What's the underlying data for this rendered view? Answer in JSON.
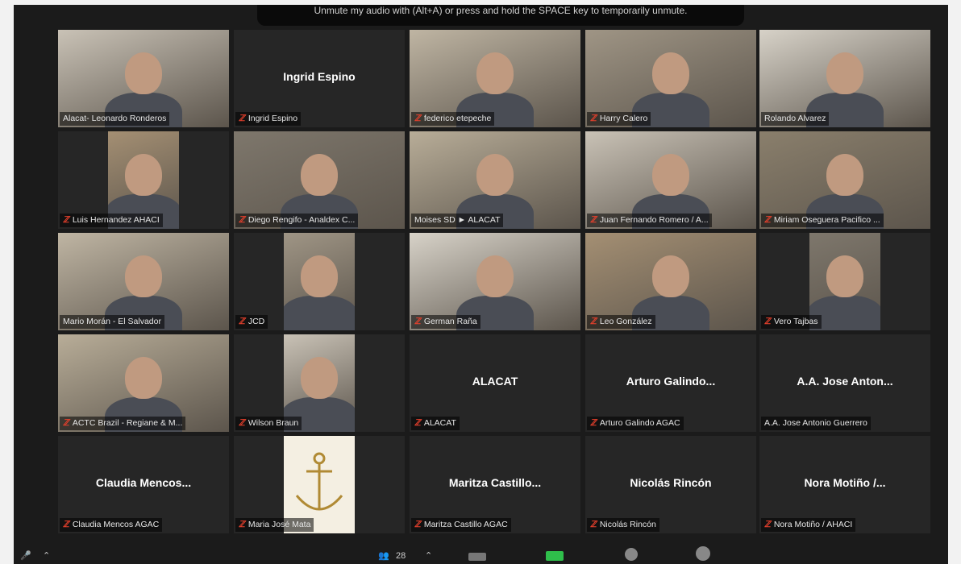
{
  "notice": "Unmute my audio with (Alt+A) or press and hold the SPACE key to temporarily unmute.",
  "colors": {
    "background": "#1b1b1b",
    "tile": "#262626",
    "speaker_outline": "#c7de6a",
    "muted_mic": "#e8402c"
  },
  "toolbar": {
    "participants_count": "28"
  },
  "participants": [
    {
      "label": "Alacat- Leonardo Ronderos",
      "big": "",
      "video": true,
      "muted": false
    },
    {
      "label": "Ingrid Espino",
      "big": "Ingrid Espino",
      "video": false,
      "muted": true
    },
    {
      "label": "federico etepeche",
      "big": "",
      "video": true,
      "muted": true
    },
    {
      "label": "Harry Calero",
      "big": "",
      "video": true,
      "muted": true
    },
    {
      "label": "Rolando Alvarez",
      "big": "",
      "video": true,
      "muted": false,
      "speaking": true
    },
    {
      "label": "Luis Hernandez AHACI",
      "big": "",
      "video": true,
      "muted": true
    },
    {
      "label": "Diego Rengifo - Analdex C...",
      "big": "",
      "video": true,
      "muted": true
    },
    {
      "label": "Moises SD ► ALACAT",
      "big": "",
      "video": true,
      "muted": false
    },
    {
      "label": "Juan Fernando Romero / A...",
      "big": "",
      "video": true,
      "muted": true
    },
    {
      "label": "Miriam Oseguera Pacifico ...",
      "big": "",
      "video": true,
      "muted": true
    },
    {
      "label": "Mario Morán - El Salvador",
      "big": "",
      "video": true,
      "muted": false
    },
    {
      "label": "JCD",
      "big": "",
      "video": true,
      "muted": true
    },
    {
      "label": "German Raña",
      "big": "",
      "video": true,
      "muted": true
    },
    {
      "label": "Leo González",
      "big": "",
      "video": true,
      "muted": true
    },
    {
      "label": "Vero Tajbas",
      "big": "",
      "video": true,
      "muted": true
    },
    {
      "label": "ACTC Brazil - Regiane & M...",
      "big": "",
      "video": true,
      "muted": true
    },
    {
      "label": "Wilson Braun",
      "big": "",
      "video": true,
      "muted": true
    },
    {
      "label": "ALACAT",
      "big": "ALACAT",
      "video": false,
      "muted": true
    },
    {
      "label": "Arturo Galindo AGAC",
      "big": "Arturo Galindo...",
      "video": false,
      "muted": true
    },
    {
      "label": "A.A. Jose Antonio Guerrero",
      "big": "A.A. Jose Anton...",
      "video": false,
      "muted": false
    },
    {
      "label": "Claudia Mencos AGAC",
      "big": "Claudia Mencos...",
      "video": false,
      "muted": true
    },
    {
      "label": "Maria José Mata",
      "big": "",
      "video": true,
      "muted": true,
      "logo": true
    },
    {
      "label": "Maritza Castillo AGAC",
      "big": "Maritza Castillo...",
      "video": false,
      "muted": true
    },
    {
      "label": "Nicolás Rincón",
      "big": "Nicolás Rincón",
      "video": false,
      "muted": true
    },
    {
      "label": "Nora Motiño / AHACI",
      "big": "Nora Motiño /...",
      "video": false,
      "muted": true
    }
  ]
}
